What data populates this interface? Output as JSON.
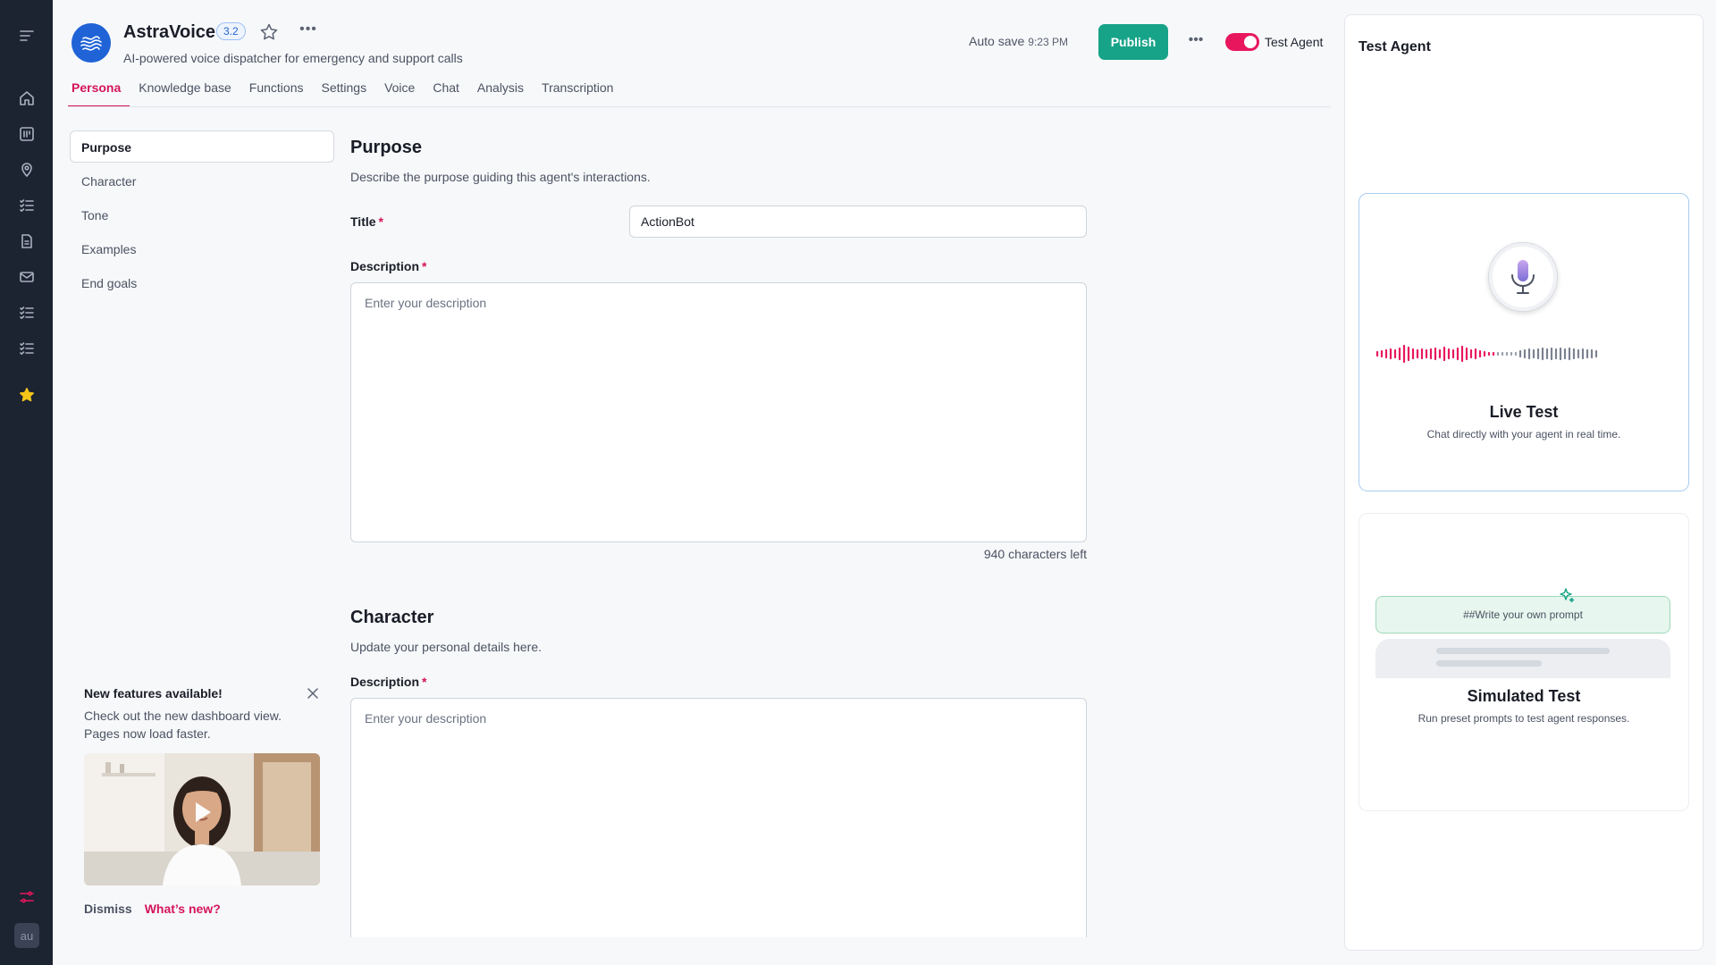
{
  "app": {
    "name": "AstraVoice",
    "version": "3.2",
    "subtitle": "AI-powered voice dispatcher for emergency and support calls"
  },
  "header": {
    "autosave_label": "Auto save",
    "autosave_time": "9:23 PM",
    "publish_label": "Publish",
    "test_agent_label": "Test Agent",
    "test_agent_enabled": true
  },
  "tabs": [
    {
      "label": "Persona",
      "active": true
    },
    {
      "label": "Knowledge base"
    },
    {
      "label": "Functions"
    },
    {
      "label": "Settings"
    },
    {
      "label": "Voice"
    },
    {
      "label": "Chat"
    },
    {
      "label": "Analysis"
    },
    {
      "label": "Transcription"
    }
  ],
  "section_nav": [
    {
      "label": "Purpose",
      "active": true
    },
    {
      "label": "Character"
    },
    {
      "label": "Tone"
    },
    {
      "label": "Examples"
    },
    {
      "label": "End goals"
    }
  ],
  "purpose": {
    "title": "Purpose",
    "description": "Describe the purpose guiding this agent's interactions.",
    "title_field_label": "Title",
    "title_value": "ActionBot",
    "description_label": "Description",
    "description_placeholder": "Enter your description",
    "chars_left": "940 characters left"
  },
  "character": {
    "title": "Character",
    "description": "Update your personal details here.",
    "description_label": "Description",
    "description_placeholder": "Enter your description"
  },
  "announcement": {
    "title": "New features available!",
    "text": "Check out the new dashboard view. Pages now load faster.",
    "dismiss_label": "Dismiss",
    "whats_new_label": "What’s new?"
  },
  "test_panel": {
    "title": "Test Agent",
    "live": {
      "title": "Live Test",
      "description": "Chat directly with your agent in real time."
    },
    "simulated": {
      "title": "Simulated Test",
      "description": "Run preset prompts to test agent responses.",
      "prompt_pill": "##Write your own prompt"
    }
  },
  "colors": {
    "accent": "#d4145a",
    "publish": "#17a388",
    "rail": "#1c2331",
    "logo": "#1f63d6",
    "starred": "#f5c518"
  },
  "rail_icons": [
    "menu-icon",
    "home-icon",
    "dashboard-icon",
    "location-icon",
    "checklist-icon",
    "document-icon",
    "mail-icon",
    "checklist-icon",
    "checklist-icon",
    "star-icon",
    "sliders-icon"
  ],
  "user": {
    "avatar_initials": "au"
  }
}
